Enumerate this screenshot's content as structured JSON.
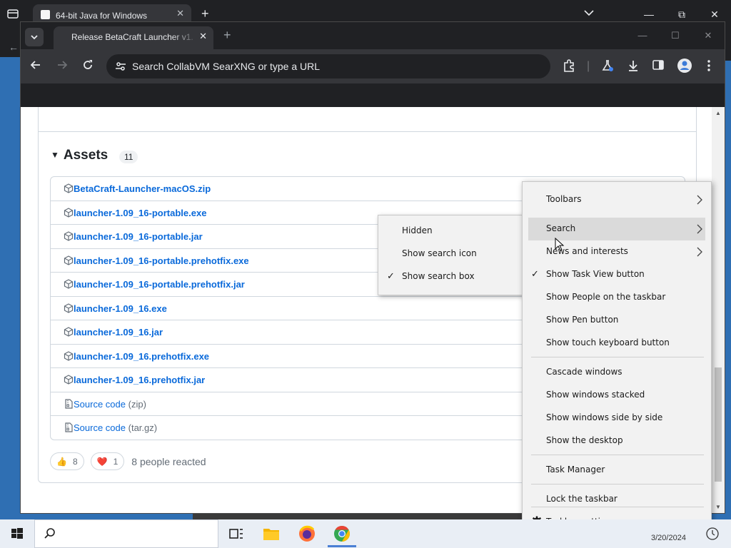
{
  "background_window": {
    "tab_title": "64-bit Java for Windows",
    "new_tab_glyph": "+",
    "window_buttons": [
      "—",
      "⧉",
      "✕"
    ]
  },
  "browser": {
    "tab_title": "Release BetaCraft Launcher v1.",
    "new_tab_glyph": "+",
    "window_buttons": [
      "—",
      "☐",
      "✕"
    ],
    "omnibox_placeholder": "Search CollabVM SearXNG or type a URL",
    "toolbar_icons": [
      "back-icon",
      "forward-icon",
      "reload-icon",
      "extensions-icon",
      "labs-icon",
      "download-icon",
      "side-panel-icon",
      "profile-icon",
      "menu-icon"
    ]
  },
  "release": {
    "assets_title": "Assets",
    "assets_count": "11",
    "assets": [
      {
        "name": "BetaCraft-Launcher-macOS.zip",
        "kind": "",
        "icon": "package-icon"
      },
      {
        "name": "launcher-1.09_16-portable.exe",
        "kind": "",
        "icon": "package-icon"
      },
      {
        "name": "launcher-1.09_16-portable.jar",
        "kind": "",
        "icon": "package-icon"
      },
      {
        "name": "launcher-1.09_16-portable.prehotfix.exe",
        "kind": "",
        "icon": "package-icon"
      },
      {
        "name": "launcher-1.09_16-portable.prehotfix.jar",
        "kind": "",
        "icon": "package-icon"
      },
      {
        "name": "launcher-1.09_16.exe",
        "kind": "",
        "icon": "package-icon"
      },
      {
        "name": "launcher-1.09_16.jar",
        "kind": "",
        "icon": "package-icon"
      },
      {
        "name": "launcher-1.09_16.prehotfix.exe",
        "kind": "",
        "icon": "package-icon"
      },
      {
        "name": "launcher-1.09_16.prehotfix.jar",
        "kind": "",
        "icon": "package-icon"
      },
      {
        "name": "Source code",
        "kind": "(zip)",
        "icon": "file-zip-icon"
      },
      {
        "name": "Source code",
        "kind": "(tar.gz)",
        "icon": "file-zip-icon"
      }
    ],
    "reactions": [
      {
        "emoji": "👍",
        "count": "8"
      },
      {
        "emoji": "❤️",
        "count": "1"
      }
    ],
    "reacted_text": "8 people reacted"
  },
  "search_submenu": {
    "items": [
      {
        "label": "Hidden",
        "checked": false
      },
      {
        "label": "Show search icon",
        "checked": false
      },
      {
        "label": "Show search box",
        "checked": true
      }
    ]
  },
  "taskbar_menu": {
    "items": [
      {
        "label": "Toolbars",
        "submenu": true
      },
      {
        "label": "Search",
        "submenu": true,
        "highlighted": true
      },
      {
        "label": "News and interests",
        "submenu": true
      },
      {
        "label": "Show Task View button",
        "checked": true
      },
      {
        "label": "Show People on the taskbar"
      },
      {
        "label": "Show Pen button"
      },
      {
        "label": "Show touch keyboard button"
      },
      {
        "label": "Cascade windows"
      },
      {
        "label": "Show windows stacked"
      },
      {
        "label": "Show windows side by side"
      },
      {
        "label": "Show the desktop"
      },
      {
        "label": "Task Manager"
      },
      {
        "label": "Lock the taskbar"
      },
      {
        "label": "Taskbar settings",
        "icon": "gear-icon"
      }
    ]
  },
  "taskbar": {
    "clock_date": "3/20/2024",
    "apps": [
      "task-view-icon",
      "file-explorer-icon",
      "firefox-icon",
      "chrome-icon"
    ]
  }
}
